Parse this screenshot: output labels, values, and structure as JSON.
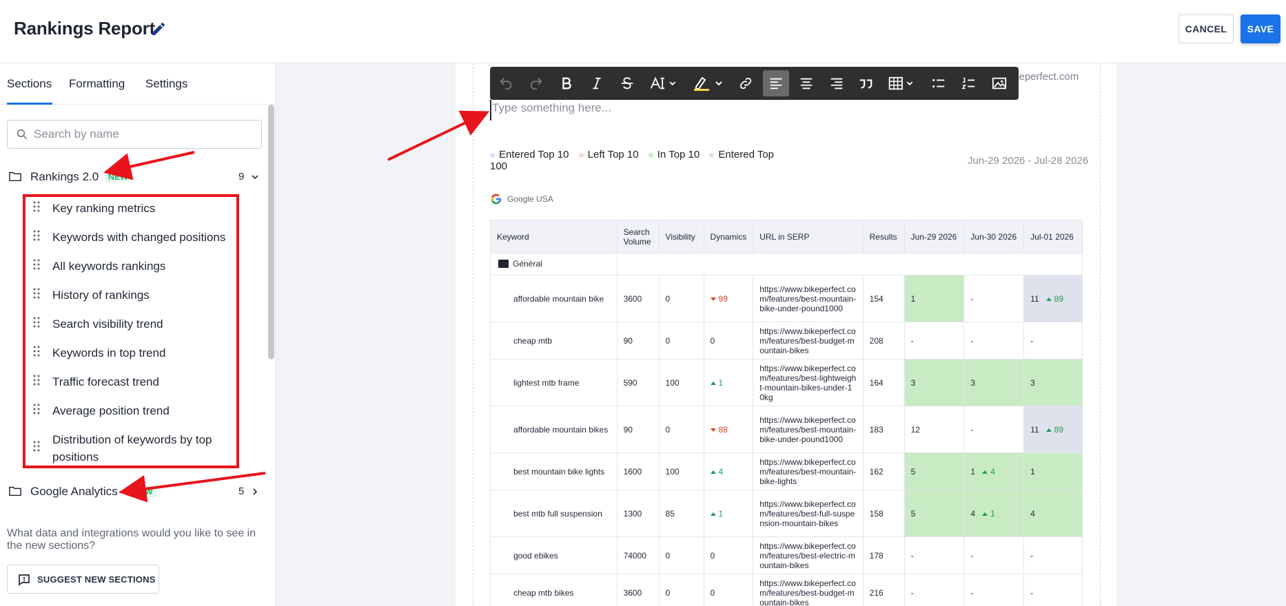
{
  "header": {
    "title": "Rankings Report",
    "cancel_label": "CANCEL",
    "save_label": "SAVE"
  },
  "sidebar": {
    "tabs": [
      {
        "label": "Sections",
        "active": true
      },
      {
        "label": "Formatting",
        "active": false
      },
      {
        "label": "Settings",
        "active": false
      }
    ],
    "search": {
      "placeholder": "Search by name",
      "value": ""
    },
    "groups": [
      {
        "label": "Rankings 2.0",
        "badge": "NEW",
        "count": "9",
        "expanded": true,
        "items": [
          "Key ranking metrics",
          "Keywords with changed positions",
          "All keywords rankings",
          "History of rankings",
          "Search visibility trend",
          "Keywords in top trend",
          "Traffic forecast trend",
          "Average position trend",
          "Distribution of keywords by top positions"
        ]
      },
      {
        "label": "Google Analytics",
        "badge": "NEW",
        "count": "5",
        "expanded": false
      }
    ],
    "feedback_text": "What data and integrations would you like to see in the new sections?",
    "suggest_label": "SUGGEST NEW SECTIONS"
  },
  "editor": {
    "domain_fragment": "keperfect.com",
    "placeholder": "Type something here...",
    "toolbar_icons": [
      "undo-icon",
      "redo-icon",
      "bold-icon",
      "italic-icon",
      "strikethrough-icon",
      "font-size-icon",
      "highlight-icon",
      "link-icon",
      "align-left-icon",
      "align-center-icon",
      "align-right-icon",
      "quote-icon",
      "table-icon",
      "bullet-list-icon",
      "numbered-list-icon",
      "image-icon"
    ],
    "legend": [
      {
        "label": "Entered Top 10",
        "color": "#d6e4f5"
      },
      {
        "label": "Left Top 10",
        "color": "#f6dccd"
      },
      {
        "label": "In Top 10",
        "color": "#c8ebc3"
      },
      {
        "label": "Entered Top 100",
        "color": "#dfe2ec"
      }
    ],
    "date_range": "Jun-29 2026 - Jul-28 2026",
    "search_engine": "Google USA",
    "table": {
      "headers": [
        "Keyword",
        "Search Volume",
        "Visibility",
        "Dynamics",
        "URL in SERP",
        "Results",
        "Jun-29 2026",
        "Jun-30 2026",
        "Jul-01 2026"
      ],
      "group_label": "Général",
      "rows": [
        {
          "keyword": "affordable mountain bike",
          "volume": "3600",
          "visibility": "0",
          "dyn": "99",
          "dyn_dir": "down",
          "url": "https://www.bikeperfect.com/features/best-mountain-bike-under-pound1000",
          "results": "154",
          "d1": "1",
          "d1_bg": "green",
          "d2": "-",
          "d2_bg": "",
          "d2_delta": "",
          "d3": "11",
          "d3_bg": "grey",
          "d3_delta": "89"
        },
        {
          "keyword": "cheap mtb",
          "volume": "90",
          "visibility": "0",
          "dyn": "0",
          "dyn_dir": "",
          "url": "https://www.bikeperfect.com/features/best-budget-mountain-bikes",
          "results": "208",
          "d1": "-",
          "d1_bg": "",
          "d2": "-",
          "d2_bg": "",
          "d2_delta": "",
          "d3": "-",
          "d3_bg": "",
          "d3_delta": ""
        },
        {
          "keyword": "lightest mtb frame",
          "volume": "590",
          "visibility": "100",
          "dyn": "1",
          "dyn_dir": "up",
          "url": "https://www.bikeperfect.com/features/best-lightweight-mountain-bikes-under-10kg",
          "results": "164",
          "d1": "3",
          "d1_bg": "green",
          "d2": "3",
          "d2_bg": "green",
          "d2_delta": "",
          "d3": "3",
          "d3_bg": "green",
          "d3_delta": ""
        },
        {
          "keyword": "affordable mountain bikes",
          "volume": "90",
          "visibility": "0",
          "dyn": "88",
          "dyn_dir": "down",
          "url": "https://www.bikeperfect.com/features/best-mountain-bike-under-pound1000",
          "results": "183",
          "d1": "12",
          "d1_bg": "",
          "d2": "-",
          "d2_bg": "",
          "d2_delta": "",
          "d3": "11",
          "d3_bg": "grey",
          "d3_delta": "89"
        },
        {
          "keyword": "best mountain bike lights",
          "volume": "1600",
          "visibility": "100",
          "dyn": "4",
          "dyn_dir": "up",
          "url": "https://www.bikeperfect.com/features/best-mountain-bike-lights",
          "results": "162",
          "d1": "5",
          "d1_bg": "green",
          "d2": "1",
          "d2_bg": "green",
          "d2_delta": "4",
          "d3": "1",
          "d3_bg": "green",
          "d3_delta": ""
        },
        {
          "keyword": "best mtb full suspension",
          "volume": "1300",
          "visibility": "85",
          "dyn": "1",
          "dyn_dir": "up",
          "url": "https://www.bikeperfect.com/features/best-full-suspension-mountain-bikes",
          "results": "158",
          "d1": "5",
          "d1_bg": "green",
          "d2": "4",
          "d2_bg": "green",
          "d2_delta": "1",
          "d3": "4",
          "d3_bg": "green",
          "d3_delta": ""
        },
        {
          "keyword": "good ebikes",
          "volume": "74000",
          "visibility": "0",
          "dyn": "0",
          "dyn_dir": "",
          "url": "https://www.bikeperfect.com/features/best-electric-mountain-bikes",
          "results": "178",
          "d1": "-",
          "d1_bg": "",
          "d2": "-",
          "d2_bg": "",
          "d2_delta": "",
          "d3": "-",
          "d3_bg": "",
          "d3_delta": ""
        },
        {
          "keyword": "cheap mtb bikes",
          "volume": "3600",
          "visibility": "0",
          "dyn": "0",
          "dyn_dir": "",
          "url": "https://www.bikeperfect.com/features/best-budget-mountain-bikes",
          "results": "216",
          "d1": "-",
          "d1_bg": "",
          "d2": "-",
          "d2_bg": "",
          "d2_delta": "",
          "d3": "-",
          "d3_bg": "",
          "d3_delta": ""
        }
      ]
    }
  },
  "colors": {
    "accent": "#1a73e8",
    "badge_green": "#26b36a",
    "in_top_cell": "#c8ebc3",
    "entered_top_cell": "#dfe2ec",
    "annotation_red": "#e8141c",
    "toolbar_bg": "#2f2f2f"
  }
}
